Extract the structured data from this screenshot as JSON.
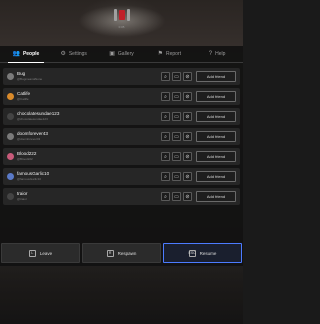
{
  "top": {
    "record_label": "0:05"
  },
  "tabs": [
    {
      "label": "People",
      "icon": "people-icon"
    },
    {
      "label": "Settings",
      "icon": "gear-icon"
    },
    {
      "label": "Gallery",
      "icon": "gallery-icon"
    },
    {
      "label": "Report",
      "icon": "report-icon"
    },
    {
      "label": "Help",
      "icon": "help-icon"
    }
  ],
  "players": [
    {
      "name": "Bug",
      "subtitle": "@BugmeandAlone"
    },
    {
      "name": "Catlife",
      "subtitle": "@Catlife"
    },
    {
      "name": "chocolatesundae123",
      "subtitle": "@chocolatesundae123"
    },
    {
      "name": "doomforever43",
      "subtitle": "@doomforever43"
    },
    {
      "name": "Blood222",
      "subtitle": "@Blood222"
    },
    {
      "name": "famousGarlic10",
      "subtitle": "@famousGarlic10"
    },
    {
      "name": "traior",
      "subtitle": "@traior"
    }
  ],
  "row_actions": {
    "add_friend_label": "Add friend"
  },
  "bottom": {
    "leave_key": "L",
    "leave_label": "Leave",
    "respawn_key": "R",
    "respawn_label": "Respawn",
    "resume_key": "ESC",
    "resume_label": "Resume"
  },
  "colors": {
    "accent": "#4c7bff",
    "record": "#c0202a"
  }
}
